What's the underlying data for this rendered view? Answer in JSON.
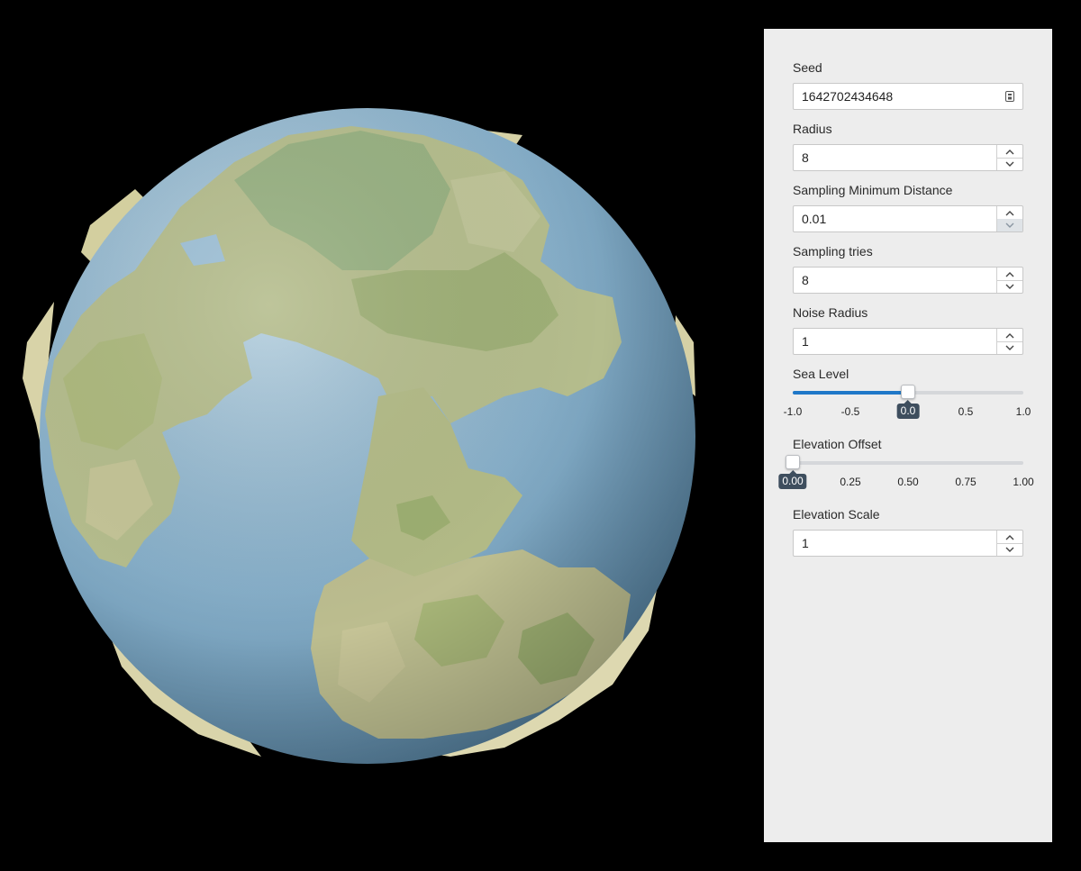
{
  "colors": {
    "ocean": "#7ea8c4",
    "land_green": "#9caf76",
    "land_tan": "#c8c397",
    "panel_bg": "#ededed",
    "accent": "#1f78c8",
    "value_badge": "#3e4e5e"
  },
  "viewport": {
    "scene": "3d-planet-globe"
  },
  "controls": {
    "seed": {
      "label": "Seed",
      "value": "1642702434648",
      "icon": "keypad-icon"
    },
    "radius": {
      "label": "Radius",
      "value": "8"
    },
    "sampling_min_distance": {
      "label": "Sampling Minimum Distance",
      "value": "0.01"
    },
    "sampling_tries": {
      "label": "Sampling tries",
      "value": "8"
    },
    "noise_radius": {
      "label": "Noise Radius",
      "value": "1"
    },
    "sea_level": {
      "label": "Sea Level",
      "value": 0.0,
      "min": -1.0,
      "max": 1.0,
      "ticks": [
        "-1.0",
        "-0.5",
        "0.0",
        "0.5",
        "1.0"
      ],
      "active_tick": 2
    },
    "elevation_offset": {
      "label": "Elevation Offset",
      "value": 0.0,
      "min": 0.0,
      "max": 1.0,
      "ticks": [
        "0.00",
        "0.25",
        "0.50",
        "0.75",
        "1.00"
      ],
      "active_tick": 0
    },
    "elevation_scale": {
      "label": "Elevation Scale",
      "value": "1"
    }
  }
}
